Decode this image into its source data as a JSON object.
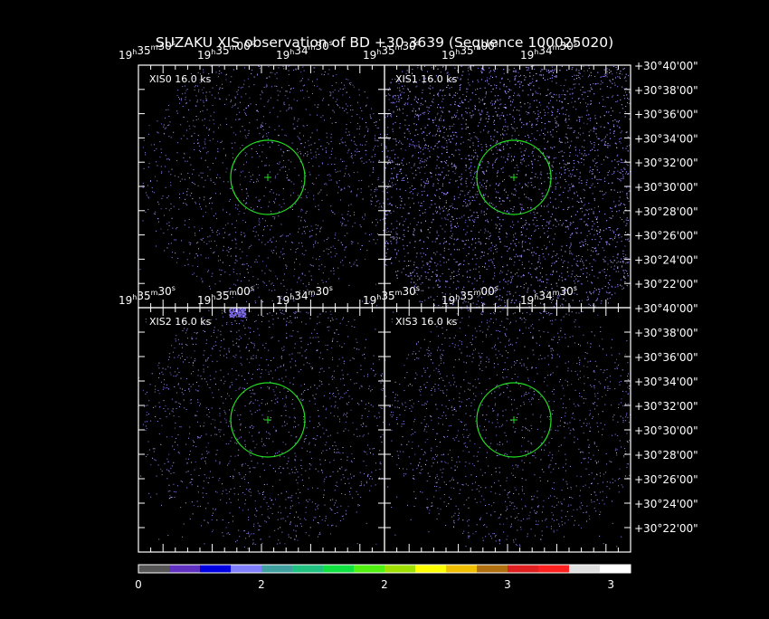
{
  "title": "SUZAKU XIS observation of BD +30 3639  (Sequence 100025020)",
  "colors": {
    "background": "#000000",
    "frame": "#ffffff",
    "region_circle": "#22dd22",
    "source_marker": "#22dd22",
    "photon_events": "#9a8cff",
    "label_text": "#ffffff"
  },
  "ra_ticks": {
    "hours": "19",
    "minutes_list": [
      "35",
      "35",
      "34"
    ],
    "seconds_list": [
      "30",
      "00",
      "30"
    ],
    "sup_h": "h",
    "sup_m": "m",
    "sup_s": "s"
  },
  "dec_ticks": {
    "deg": "+30",
    "minutes": [
      "40",
      "38",
      "36",
      "34",
      "32",
      "30",
      "28",
      "26",
      "24",
      "22"
    ],
    "deg_sign": "°",
    "arcmin_sign": "'",
    "arcsec": "00",
    "arcsec_sign": "\""
  },
  "chart_data": {
    "type": "heatmap",
    "title": "SUZAKU XIS observation of BD +30 3639  (Sequence 100025020)",
    "x_axis": "Right Ascension",
    "y_axis": "Declination",
    "panels": [
      {
        "label": "XIS0",
        "exposure": "16.0 ks",
        "ra_ticks": [
          "19h35m30s",
          "19h35m00s",
          "19h34m30s"
        ],
        "dec_ticks": [
          "+30°40'00\"",
          "+30°38'00\"",
          "+30°36'00\"",
          "+30°34'00\"",
          "+30°32'00\"",
          "+30°30'00\"",
          "+30°28'00\"",
          "+30°26'00\"",
          "+30°24'00\"",
          "+30°22'00\""
        ],
        "field_shape": "rounded"
      },
      {
        "label": "XIS1",
        "exposure": "16.0 ks",
        "ra_ticks": [
          "19h35m30s",
          "19h35m00s",
          "19h34m30s"
        ],
        "dec_ticks": [
          "+30°40'00\"",
          "+30°38'00\"",
          "+30°36'00\"",
          "+30°34'00\"",
          "+30°32'00\"",
          "+30°30'00\"",
          "+30°28'00\"",
          "+30°26'00\"",
          "+30°24'00\"",
          "+30°22'00\""
        ],
        "field_shape": "rotated-square"
      },
      {
        "label": "XIS2",
        "exposure": "16.0 ks",
        "ra_ticks": [
          "19h35m30s",
          "19h35m00s",
          "19h34m30s"
        ],
        "dec_ticks": [
          "+30°40'00\"",
          "+30°38'00\"",
          "+30°36'00\"",
          "+30°34'00\"",
          "+30°32'00\"",
          "+30°30'00\"",
          "+30°28'00\"",
          "+30°26'00\"",
          "+30°24'00\"",
          "+30°22'00\""
        ],
        "field_shape": "rounded"
      },
      {
        "label": "XIS3",
        "exposure": "16.0 ks",
        "ra_ticks": [
          "19h35m30s",
          "19h35m00s",
          "19h34m30s"
        ],
        "dec_ticks": [
          "+30°40'00\"",
          "+30°38'00\"",
          "+30°36'00\"",
          "+30°34'00\"",
          "+30°32'00\"",
          "+30°30'00\"",
          "+30°28'00\"",
          "+30°26'00\"",
          "+30°24'00\"",
          "+30°22'00\""
        ],
        "field_shape": "rounded"
      }
    ],
    "colorbar": {
      "colors": [
        "#555555",
        "#6030c0",
        "#0000e0",
        "#8080ff",
        "#40a0a0",
        "#20c080",
        "#10e040",
        "#50f010",
        "#a0e000",
        "#ffff00",
        "#f0c000",
        "#b07010",
        "#e02020",
        "#ff2020",
        "#e0e0e0",
        "#ffffff"
      ],
      "tick_labels": [
        "0",
        "2",
        "2",
        "3",
        "3"
      ],
      "tick_fractions": [
        0.0,
        0.25,
        0.5,
        0.75,
        0.96
      ]
    }
  }
}
